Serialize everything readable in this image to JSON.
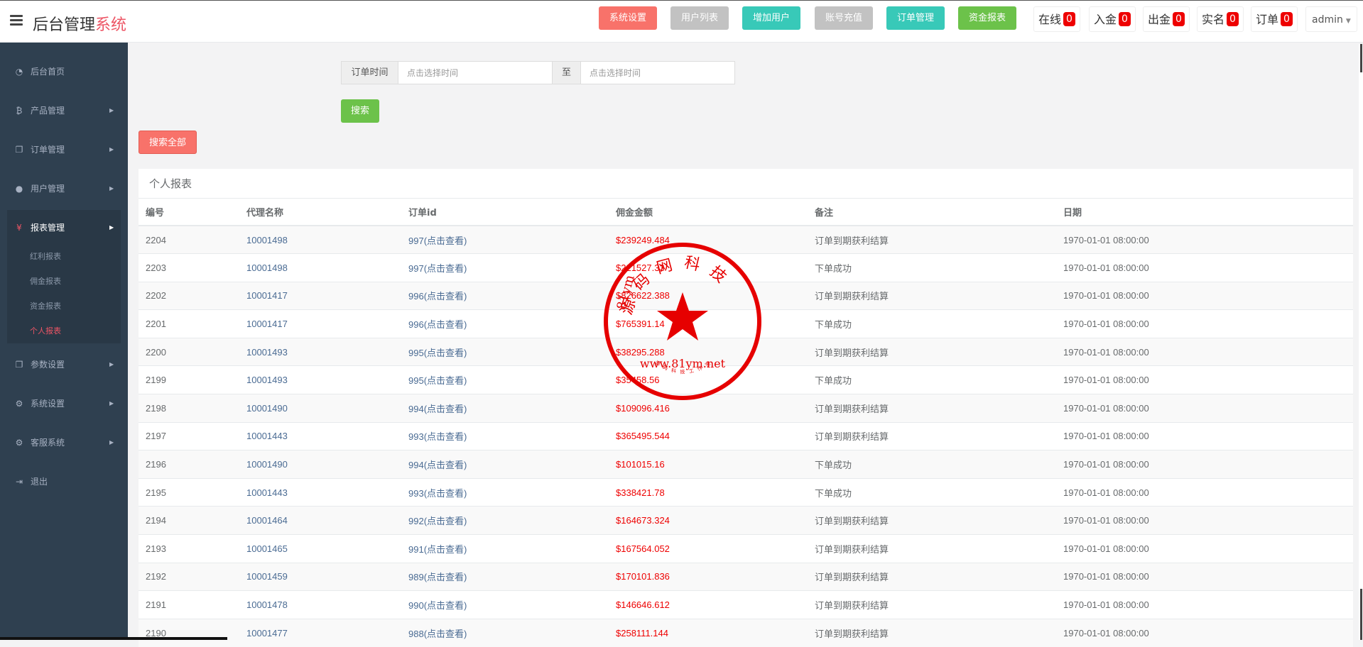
{
  "header": {
    "title_main": "后台管理",
    "title_accent": "系统",
    "buttons": [
      {
        "label": "系统设置",
        "color": "#f8726a"
      },
      {
        "label": "用户列表",
        "color": "#c2c2c2"
      },
      {
        "label": "增加用户",
        "color": "#38c9b8"
      },
      {
        "label": "账号充值",
        "color": "#c2c2c2"
      },
      {
        "label": "订单管理",
        "color": "#38c9b8"
      },
      {
        "label": "资金报表",
        "color": "#6cc24a"
      }
    ],
    "stats": [
      {
        "label": "在线",
        "count": "0"
      },
      {
        "label": "入金",
        "count": "0"
      },
      {
        "label": "出金",
        "count": "0"
      },
      {
        "label": "实名",
        "count": "0"
      },
      {
        "label": "订单",
        "count": "0"
      }
    ],
    "user": "admin"
  },
  "sidebar": {
    "items": [
      {
        "label": "后台首页",
        "icon": "dashboard-icon"
      },
      {
        "label": "产品管理",
        "icon": "bitcoin-icon"
      },
      {
        "label": "订单管理",
        "icon": "copy-icon"
      },
      {
        "label": "用户管理",
        "icon": "user-icon"
      },
      {
        "label": "报表管理",
        "icon": "yen-icon"
      },
      {
        "label": "参数设置",
        "icon": "copy-icon"
      },
      {
        "label": "系统设置",
        "icon": "gears-icon"
      },
      {
        "label": "客服系统",
        "icon": "gears-icon"
      },
      {
        "label": "退出",
        "icon": "sign-out-icon"
      }
    ],
    "sub_items": [
      "红利报表",
      "佣金报表",
      "资金报表",
      "个人报表"
    ]
  },
  "search": {
    "time_label": "订单时间",
    "start_placeholder": "点击选择时间",
    "to_label": "至",
    "end_placeholder": "点击选择时间",
    "search_button": "搜索",
    "search_all_button": "搜索全部"
  },
  "report": {
    "title": "个人报表",
    "columns": [
      "编号",
      "代理名称",
      "订单id",
      "佣金金额",
      "备注",
      "日期"
    ],
    "rows": [
      [
        "2204",
        "10001498",
        "997(点击查看)",
        "$239249.484",
        "订单到期获利结算",
        "1970-01-01 08:00:00"
      ],
      [
        "2203",
        "10001498",
        "997(点击查看)",
        "$221527.33",
        "下单成功",
        "1970-01-01 08:00:00"
      ],
      [
        "2202",
        "10001417",
        "996(点击查看)",
        "$826622.388",
        "订单到期获利结算",
        "1970-01-01 08:00:00"
      ],
      [
        "2201",
        "10001417",
        "996(点击查看)",
        "$765391.14",
        "下单成功",
        "1970-01-01 08:00:00"
      ],
      [
        "2200",
        "10001493",
        "995(点击查看)",
        "$38295.288",
        "订单到期获利结算",
        "1970-01-01 08:00:00"
      ],
      [
        "2199",
        "10001493",
        "995(点击查看)",
        "$35458.56",
        "下单成功",
        "1970-01-01 08:00:00"
      ],
      [
        "2198",
        "10001490",
        "994(点击查看)",
        "$109096.416",
        "订单到期获利结算",
        "1970-01-01 08:00:00"
      ],
      [
        "2197",
        "10001443",
        "993(点击查看)",
        "$365495.544",
        "订单到期获利结算",
        "1970-01-01 08:00:00"
      ],
      [
        "2196",
        "10001490",
        "994(点击查看)",
        "$101015.16",
        "下单成功",
        "1970-01-01 08:00:00"
      ],
      [
        "2195",
        "10001443",
        "993(点击查看)",
        "$338421.78",
        "下单成功",
        "1970-01-01 08:00:00"
      ],
      [
        "2194",
        "10001464",
        "992(点击查看)",
        "$164673.324",
        "订单到期获利结算",
        "1970-01-01 08:00:00"
      ],
      [
        "2193",
        "10001465",
        "991(点击查看)",
        "$167564.052",
        "订单到期获利结算",
        "1970-01-01 08:00:00"
      ],
      [
        "2192",
        "10001459",
        "989(点击查看)",
        "$170101.836",
        "订单到期获利结算",
        "1970-01-01 08:00:00"
      ],
      [
        "2191",
        "10001478",
        "990(点击查看)",
        "$146646.612",
        "订单到期获利结算",
        "1970-01-01 08:00:00"
      ],
      [
        "2190",
        "10001477",
        "988(点击查看)",
        "$258111.144",
        "订单到期获利结算",
        "1970-01-01 08:00:00"
      ]
    ]
  },
  "watermark": {
    "arc_text": "源码网科技",
    "side_text": "81ym",
    "url": "www.81ym.net",
    "bottom_text": "源码科技工作室",
    "color": "#e60000"
  },
  "colors": {
    "sidebar_bg": "#2f4050",
    "accent_red": "#ed5565",
    "search_green": "#6cc24a",
    "search_all": "#f8726a"
  }
}
